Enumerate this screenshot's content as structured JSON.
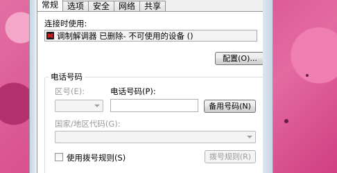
{
  "tabs": [
    "常规",
    "选项",
    "安全",
    "网络",
    "共享"
  ],
  "connect_using_label": "连接时使用:",
  "device_name": "调制解调器 已删除- 不可使用的设备 ()",
  "configure_button": "配置(O)...",
  "phone_group_title": "电话号码",
  "area_code_label": "区号(E):",
  "phone_number_label": "电话号码(P):",
  "phone_number_value": "",
  "alternates_button": "备用号码(N)",
  "country_code_label": "国家/地区代码(G):",
  "use_dialing_rules_label": "使用拨号规则(S)",
  "dialing_rules_button": "拨号规则(R)",
  "icons": {
    "device": "modem-icon",
    "combo_arrow": "chevron-down-icon"
  },
  "colors": {
    "wallpaper": "#d44a8a",
    "dialog_background": "#f0f0f0",
    "panel_background": "#ffffff",
    "disabled_text": "#9a9a9a"
  }
}
